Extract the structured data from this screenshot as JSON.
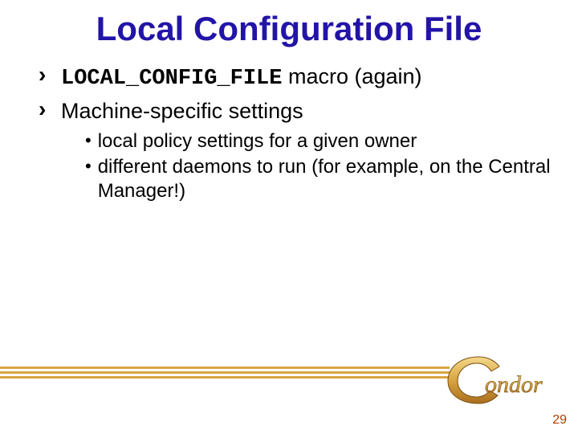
{
  "title": "Local Configuration File",
  "bullets": [
    {
      "code": "LOCAL_CONFIG_FILE",
      "rest": " macro (again)"
    },
    {
      "text": "Machine-specific settings"
    }
  ],
  "subbullets": [
    "local policy settings for a given owner",
    "different daemons to run (for example, on the Central Manager!)"
  ],
  "logo_text": "ondor",
  "page_number": "29",
  "colors": {
    "title": "#2314a8",
    "accent": "#d9a441",
    "pagenum": "#b33a00"
  }
}
